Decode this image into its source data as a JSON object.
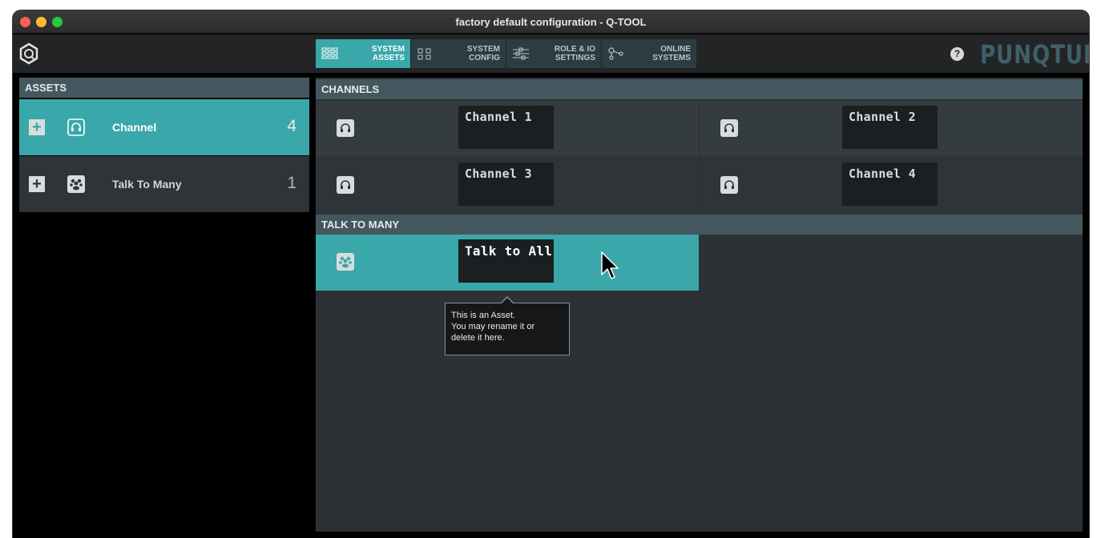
{
  "window": {
    "title": "factory default configuration - Q-TOOL"
  },
  "toolbar": {
    "tabs": [
      {
        "label": "SYSTEM\nASSETS",
        "icon": "grid-icon",
        "active": true
      },
      {
        "label": "SYSTEM\nCONFIG",
        "icon": "config-icon",
        "active": false
      },
      {
        "label": "ROLE & IO\nSETTINGS",
        "icon": "sliders-icon",
        "active": false
      },
      {
        "label": "ONLINE\nSYSTEMS",
        "icon": "network-icon",
        "active": false
      }
    ],
    "help": "?",
    "brand": "PUNQTUM"
  },
  "assets": {
    "header": "ASSETS",
    "items": [
      {
        "name": "Channel",
        "count": "4",
        "icon": "headset-icon",
        "add": "+"
      },
      {
        "name": "Talk To Many",
        "count": "1",
        "icon": "group-icon",
        "add": "+"
      }
    ]
  },
  "channels": {
    "header": "CHANNELS",
    "items": [
      {
        "name": "Channel 1"
      },
      {
        "name": "Channel 2"
      },
      {
        "name": "Channel 3"
      },
      {
        "name": "Channel 4"
      }
    ]
  },
  "talk_to_many": {
    "header": "TALK TO MANY",
    "items": [
      {
        "name": "Talk to All"
      }
    ]
  },
  "tooltip": {
    "line1": "This is an Asset.",
    "line2": "You may rename it or",
    "line3": "delete it here."
  },
  "colors": {
    "accent": "#3aa7aa",
    "header": "#44575f",
    "panel": "#2b3134"
  }
}
